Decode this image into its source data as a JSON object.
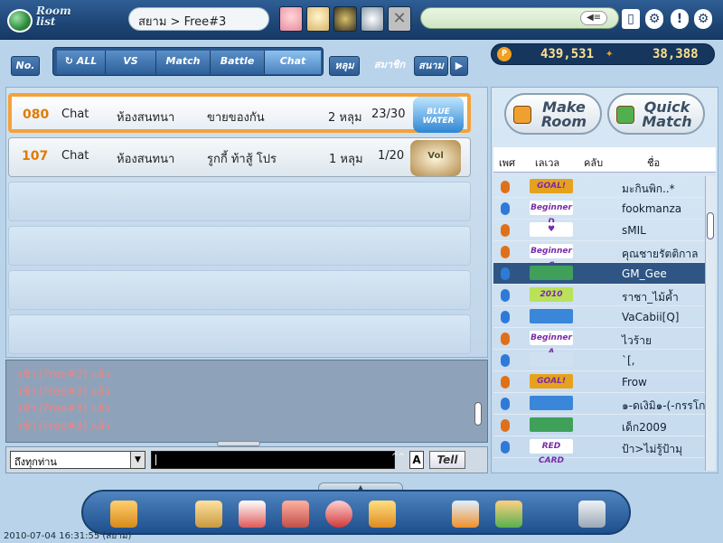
{
  "header": {
    "logo_text": "Room list",
    "breadcrumb": "สยาม > Free#3",
    "speaker_label": "◀≡"
  },
  "tabs": {
    "no_label": "No.",
    "group": [
      "ALL",
      "VS",
      "Match",
      "Battle",
      "Chat"
    ],
    "right_tabs": [
      "หลุม",
      "สมาชิก",
      "สนาม"
    ],
    "next_label": "▶"
  },
  "money": {
    "gold": "439,531",
    "points": "38,388"
  },
  "rooms": [
    {
      "num": "080",
      "type": "Chat",
      "mode": "ห้องสนทนา",
      "title": "ขายของกัน",
      "holes": "2 หลุม",
      "players": "23/30",
      "map": "BLUE WATER",
      "selected": true
    },
    {
      "num": "107",
      "type": "Chat",
      "mode": "ห้องสนทนา",
      "title": "รูกกี้ ท้าสู้ โปร",
      "holes": "1 หลุม",
      "players": "1/20",
      "map": "Vol",
      "selected": false
    }
  ],
  "chat_log": [
    "เข้า [Free#2] แล้ว",
    "เข้า [Free#3] แล้ว",
    "เข้า [Free#3] แล้ว",
    "เข้า [Free#3] แล้ว"
  ],
  "input": {
    "target": "ถึงทุกท่าน",
    "caps_label": "^^",
    "a_label": "A",
    "tell_label": "Tell"
  },
  "right": {
    "make_room": "Make Room",
    "quick_match": "Quick Match",
    "header": [
      "เพศ",
      "เลเวล",
      "คลับ",
      "ชื่อ"
    ]
  },
  "players": [
    {
      "name": "มะกินพิก..*",
      "level": "GOAL!",
      "level_color": "#e6a21c",
      "gender_color": "#e07018",
      "selected": false
    },
    {
      "name": "fookmanza",
      "level": "Beginner D",
      "level_color": "#ffffff",
      "gender_color": "#2f7ad8",
      "selected": false
    },
    {
      "name": "sMIL",
      "level": "♥",
      "level_color": "#ffffff",
      "gender_color": "#e07018",
      "selected": false
    },
    {
      "name": "คุณชายรัตติกาล",
      "level": "Beginner C",
      "level_color": "#ffffff",
      "gender_color": "#e07018",
      "selected": false
    },
    {
      "name": "GM_Gee",
      "level": "",
      "level_color": "#3fa05a",
      "gender_color": "#2f7ad8",
      "selected": true
    },
    {
      "name": "ราชา_ไม้ค้ำ",
      "level": "2010",
      "level_color": "#b9e15a",
      "gender_color": "#2f7ad8",
      "selected": false
    },
    {
      "name": "VaCabii[Q]",
      "level": "",
      "level_color": "#3a86d8",
      "gender_color": "#2f7ad8",
      "selected": false
    },
    {
      "name": "ไวร้าย",
      "level": "Beginner A",
      "level_color": "#ffffff",
      "gender_color": "#e07018",
      "selected": false
    },
    {
      "name": "`[,",
      "level": "",
      "level_color": "#cfe0f0",
      "gender_color": "#2f7ad8",
      "selected": false
    },
    {
      "name": "Frow",
      "level": "GOAL!",
      "level_color": "#e6a21c",
      "gender_color": "#e07018",
      "selected": false
    },
    {
      "name": "๑-ดเงิมิ๑-(-กรรโก",
      "level": "",
      "level_color": "#3a86d8",
      "gender_color": "#2f7ad8",
      "selected": false
    },
    {
      "name": "เด็ก2009",
      "level": "",
      "level_color": "#3fa05a",
      "gender_color": "#e07018",
      "selected": false
    },
    {
      "name": "ป้า>ไม่รู้ป้ามุ",
      "level": "RED CARD",
      "level_color": "#ffffff",
      "gender_color": "#2f7ad8",
      "selected": false
    }
  ],
  "timestamp": "2010-07-04 16:31:55 (สยาม)"
}
